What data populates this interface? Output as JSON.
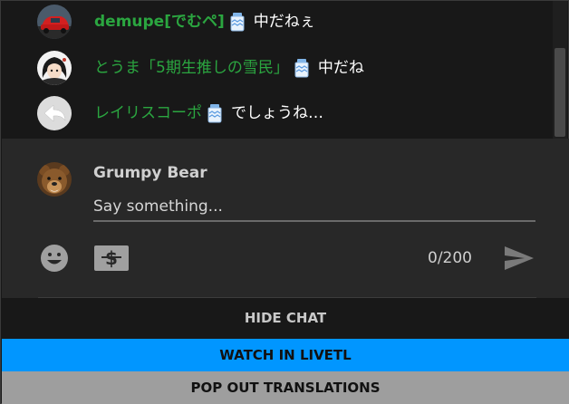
{
  "chat": {
    "messages": [
      {
        "author": "demupe[でむペ]",
        "author_is_owner_style": true,
        "text": "中だねぇ",
        "has_jar_emoji": true,
        "avatar": "red-car-avatar"
      },
      {
        "author": "とうま「5期生推しの雪民」",
        "author_is_owner_style": false,
        "text": "中だね",
        "has_jar_emoji": true,
        "avatar": "anime-girl-avatar"
      },
      {
        "author": "レイリスコーポ",
        "author_is_owner_style": false,
        "text": "でしょうね…",
        "has_jar_emoji": true,
        "avatar": "back-arrow-avatar"
      }
    ],
    "colors": {
      "author": "#2ba640",
      "text": "#ffffff",
      "background": "#181818"
    }
  },
  "composer": {
    "user_name": "Grumpy Bear",
    "placeholder": "Say something...",
    "char_count": "0/200",
    "icons": {
      "emoji": "smiley-face-icon",
      "superchat": "dollar-bill-icon",
      "send": "send-arrow-icon"
    }
  },
  "buttons": {
    "hide_chat": "HIDE CHAT",
    "watch_livetl": "WATCH IN LIVETL",
    "popout": "POP OUT TRANSLATIONS"
  },
  "accent_colors": {
    "livetl": "#0196ff",
    "popout": "#9e9e9e"
  }
}
